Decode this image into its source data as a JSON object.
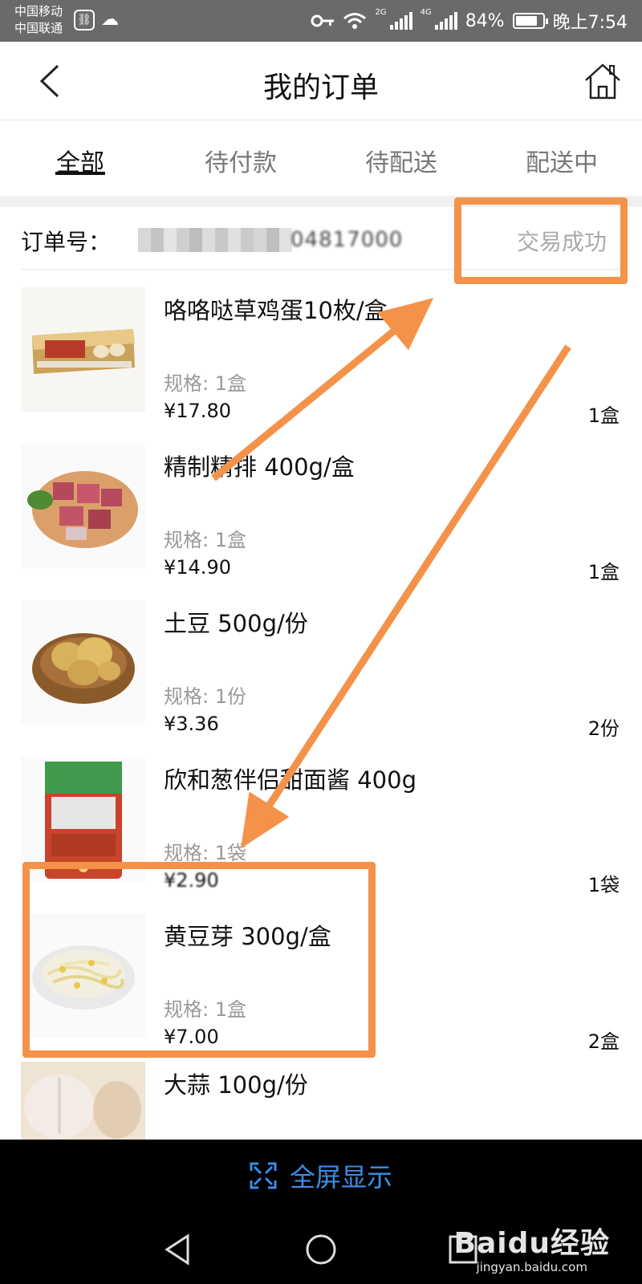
{
  "status_bar": {
    "carrier_1": "中国移动",
    "carrier_2": "中国联通",
    "net_tag_1": "2G",
    "net_tag_2": "4G",
    "battery_text": "84%",
    "battery_level": 0.84,
    "time": "晚上7:54"
  },
  "header": {
    "title": "我的订单",
    "back_icon": "chevron-left-icon",
    "home_icon": "home-icon"
  },
  "tabs": [
    {
      "label": "全部",
      "active": true
    },
    {
      "label": "待付款",
      "active": false
    },
    {
      "label": "待配送",
      "active": false
    },
    {
      "label": "配送中",
      "active": false
    }
  ],
  "order": {
    "label": "订单号：",
    "number_visible": "04817000",
    "status": "交易成功"
  },
  "items": [
    {
      "name": "咯咯哒草鸡蛋10枚/盒",
      "spec": "规格: 1盒",
      "price": "¥17.80",
      "qty": "1盒",
      "image_icon": "eggs-image"
    },
    {
      "name": "精制精排 400g/盒",
      "spec": "规格: 1盒",
      "price": "¥14.90",
      "qty": "1盒",
      "image_icon": "pork-ribs-image"
    },
    {
      "name": "土豆 500g/份",
      "spec": "规格: 1份",
      "price": "¥3.36",
      "qty": "2份",
      "image_icon": "potatoes-image"
    },
    {
      "name": "欣和葱伴侣甜面酱 400g",
      "spec": "规格: 1袋",
      "price": "¥2.90",
      "qty": "1袋",
      "image_icon": "sauce-bag-image"
    },
    {
      "name": "黄豆芽 300g/盒",
      "spec": "规格: 1盒",
      "price": "¥7.00",
      "qty": "2盒",
      "image_icon": "bean-sprouts-image"
    },
    {
      "name": "大蒜 100g/份",
      "spec": "",
      "price": "",
      "qty": "",
      "image_icon": "garlic-image"
    }
  ],
  "fullscreen": {
    "label": "全屏显示",
    "icon": "expand-icon"
  },
  "watermark": {
    "logo": "Baidu经验",
    "sub": "jingyan.baidu.com"
  },
  "colors": {
    "annotation_orange": "#f4924a",
    "fullscreen_blue": "#3a8ee6",
    "status_bar_bg": "#6a6a6a"
  }
}
